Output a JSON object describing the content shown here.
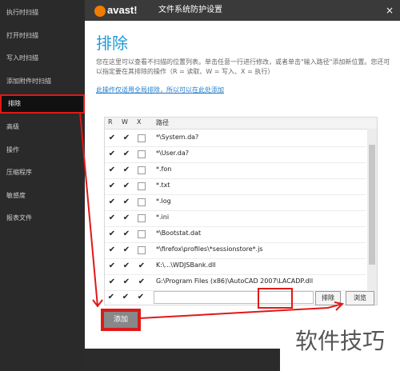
{
  "sidebar": {
    "items": [
      {
        "label": "执行时扫描"
      },
      {
        "label": "打开时扫描"
      },
      {
        "label": "写入时扫描"
      },
      {
        "label": "添加附件时扫描"
      },
      {
        "label": "排除",
        "active": true
      },
      {
        "label": "高级"
      },
      {
        "label": "操作"
      },
      {
        "label": "压缩程序"
      },
      {
        "label": "敏感度"
      },
      {
        "label": "报表文件"
      }
    ]
  },
  "window": {
    "logo": "avast!",
    "title": "文件系统防护设置",
    "close": "×"
  },
  "main": {
    "heading": "排除",
    "description": "您在这里可以查看不扫描的位置列表。单击任意一行进行修改，或者单击\"输入路径\"添加新位置。您还可以指定要在其排除的操作（R = 读取、W = 写入、X = 执行）",
    "link": "此操作仅适用全局排除，所以可以在此处添加"
  },
  "table": {
    "headers": {
      "r": "R",
      "w": "W",
      "x": "X",
      "path": "路径"
    },
    "rows": [
      {
        "r": true,
        "w": true,
        "x": false,
        "path": "*\\System.da?"
      },
      {
        "r": true,
        "w": true,
        "x": false,
        "path": "*\\User.da?"
      },
      {
        "r": true,
        "w": true,
        "x": false,
        "path": "*.fon"
      },
      {
        "r": true,
        "w": true,
        "x": false,
        "path": "*.txt"
      },
      {
        "r": true,
        "w": true,
        "x": false,
        "path": "*.log"
      },
      {
        "r": true,
        "w": true,
        "x": false,
        "path": "*.ini"
      },
      {
        "r": true,
        "w": true,
        "x": false,
        "path": "*\\Bootstat.dat"
      },
      {
        "r": true,
        "w": true,
        "x": false,
        "path": "*\\firefox\\profiles\\*sessionstore*.js"
      },
      {
        "r": true,
        "w": true,
        "x": true,
        "path": "K:\\...\\WDJSBank.dll"
      },
      {
        "r": true,
        "w": true,
        "x": true,
        "path": "G:\\Program Files (x86)\\AutoCAD 2007\\LACADP.dll"
      }
    ]
  },
  "new_row": {
    "r": true,
    "w": true,
    "x": true,
    "path_value": "",
    "remove_label": "排除",
    "browse_label": "浏览"
  },
  "add_label": "添加",
  "watermark": "软件技巧",
  "colors": {
    "accent": "#1e9ad6",
    "highlight": "#e01818",
    "brand": "#f07c00"
  }
}
